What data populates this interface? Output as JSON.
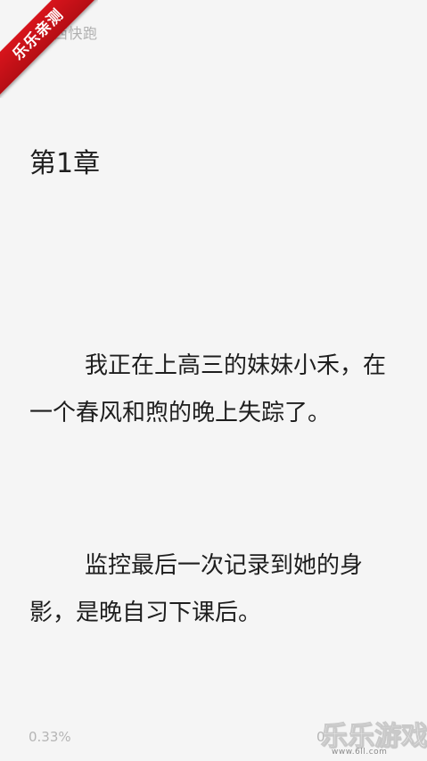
{
  "reader": {
    "book_title": "西快跑",
    "chapter_title": "第1章",
    "paragraphs": [
      "我正在上高三的妹妹小禾，在一个春风和煦的晚上失踪了。",
      "监控最后一次记录到她的身影，是晚自习下课后。"
    ],
    "progress_percent": "0.33%",
    "progress_right": "0"
  },
  "overlays": {
    "ribbon_text": "乐乐亲测",
    "watermark_main": "乐乐游戏",
    "watermark_url": "www.6ll.com"
  },
  "colors": {
    "background": "#f5f5f5",
    "text": "#1e1e1e",
    "muted_text": "#b0b0b0",
    "ribbon": "#d8141c"
  }
}
